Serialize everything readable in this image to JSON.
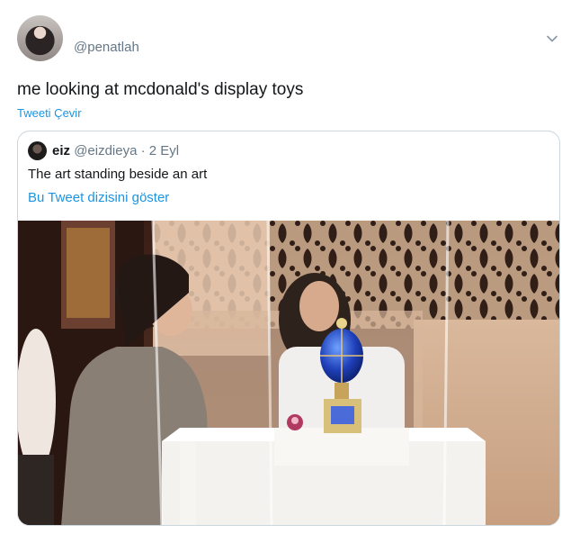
{
  "tweet": {
    "handle": "@penatlah",
    "text": "me looking at mcdonald's display toys",
    "translate_label": "Tweeti Çevir",
    "menu_icon": "chevron-down-icon"
  },
  "quoted": {
    "name": "eiz",
    "handle": "@eizdieya",
    "separator": "·",
    "date": "2 Eyl",
    "text": "The art standing beside an art",
    "thread_link": "Bu Tweet dizisini göster"
  },
  "colors": {
    "link": "#1b95e0",
    "secondary_text": "#657786",
    "border": "#ccd6dd"
  }
}
